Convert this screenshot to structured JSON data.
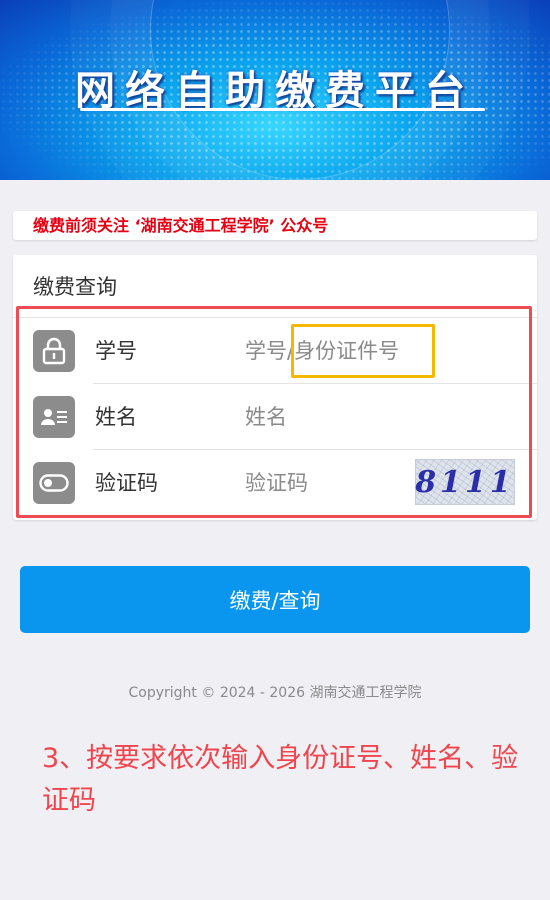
{
  "banner": {
    "title": "网络自助缴费平台"
  },
  "notice": {
    "text": "缴费前须关注 ‘湖南交通工程学院’ 公众号"
  },
  "panel": {
    "title": "缴费查询",
    "fields": [
      {
        "label": "学号",
        "placeholder": "学号/身份证件号",
        "icon": "lock-icon"
      },
      {
        "label": "姓名",
        "placeholder": "姓名",
        "icon": "id-card-icon"
      },
      {
        "label": "验证码",
        "placeholder": "验证码",
        "icon": "toggle-icon"
      }
    ],
    "captcha_text": "8111"
  },
  "submit": {
    "label": "缴费/查询"
  },
  "footer": {
    "copyright": "Copyright © 2024 - 2026 湖南交通工程学院"
  },
  "annotation": {
    "instruction": "3、按要求依次输入身份证号、姓名、验证码"
  },
  "colors": {
    "accent": "#0a96ee",
    "notice_text": "#e60012",
    "highlight_red": "#f04a52",
    "highlight_yellow": "#f5b800",
    "annotation_text": "#f0454d"
  }
}
